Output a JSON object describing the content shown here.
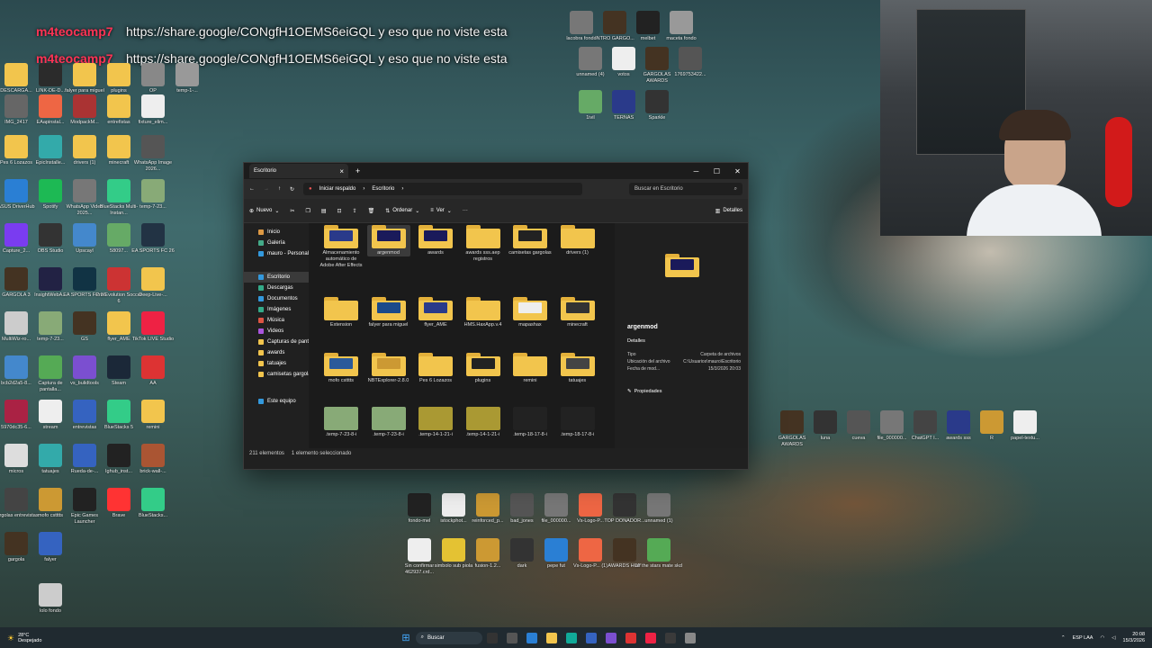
{
  "overlay": {
    "line1_user": "m4teocamp7",
    "line1_text": "https://share.google/CONgfH1OEMS6eiGQL y eso que no viste esta",
    "line2_user": "m4teocamp7",
    "line2_text": "https://share.google/CONgfH1OEMS6eiGQL y eso que no viste esta"
  },
  "desktop_icons": [
    {
      "label": "DESCARGA...",
      "color": "#f2c54d"
    },
    {
      "label": "LINK-DE-D...",
      "color": "#2b2b2b"
    },
    {
      "label": "falyer para miguel",
      "color": "#f2c54d"
    },
    {
      "label": "plugins",
      "color": "#f2c54d"
    },
    {
      "label": "OP",
      "color": "#888"
    },
    {
      "label": "temp-1-...",
      "color": "#999"
    },
    {
      "label": "IMG_2417",
      "color": "#666"
    },
    {
      "label": "EAapinstal...",
      "color": "#e64"
    },
    {
      "label": "ModpackM...",
      "color": "#a33"
    },
    {
      "label": "entrefistas",
      "color": "#f2c54d"
    },
    {
      "label": "fixture_elim...",
      "color": "#eee"
    },
    {
      "label": "Pes 6 Lozazos",
      "color": "#f2c54d"
    },
    {
      "label": "EpicInstalle...",
      "color": "#3aa"
    },
    {
      "label": "drivers (1)",
      "color": "#f2c54d"
    },
    {
      "label": "minecraft",
      "color": "#f2c54d"
    },
    {
      "label": "WhatsApp Image 2026...",
      "color": "#555"
    },
    {
      "label": "ASUS DriverHub",
      "color": "#2a7fd4"
    },
    {
      "label": "Spotify",
      "color": "#1db954"
    },
    {
      "label": "WhatsApp Video 2025...",
      "color": "#777"
    },
    {
      "label": "BlueStacks Multi-Instan...",
      "color": "#3c8"
    },
    {
      "label": "temp-7-23...",
      "color": "#8a7"
    },
    {
      "label": "Capture_2...",
      "color": "#7a3cf0"
    },
    {
      "label": "OBS Studio",
      "color": "#333"
    },
    {
      "label": "Upscayl",
      "color": "#48c"
    },
    {
      "label": "58097...",
      "color": "#6a6"
    },
    {
      "label": "EA SPORTS FC 26",
      "color": "#234"
    },
    {
      "label": "GARGOLA 3",
      "color": "#432"
    },
    {
      "label": "InsightWebA...",
      "color": "#224"
    },
    {
      "label": "EA SPORTS FC 26",
      "color": "#134"
    },
    {
      "label": "Pro Evolution Soccer 6",
      "color": "#c33"
    },
    {
      "label": "Deep-Live-...",
      "color": "#f2c54d"
    },
    {
      "label": "MultiWiz-ro...",
      "color": "#ccc"
    },
    {
      "label": "temp-7-23...",
      "color": "#8a7"
    },
    {
      "label": "GS",
      "color": "#432"
    },
    {
      "label": "flyer_AME",
      "color": "#f2c54d"
    },
    {
      "label": "TikTok LIVE Studio",
      "color": "#e24"
    },
    {
      "label": "bcb2d2a5-8...",
      "color": "#48c"
    },
    {
      "label": "Captura de pantalla...",
      "color": "#5a5"
    },
    {
      "label": "vs_bulidtools",
      "color": "#7b4fd0"
    },
    {
      "label": "Steam",
      "color": "#1b2838"
    },
    {
      "label": "AA",
      "color": "#d33"
    },
    {
      "label": "5970dc35-6...",
      "color": "#a24"
    },
    {
      "label": "stream",
      "color": "#eee"
    },
    {
      "label": "entrevistas",
      "color": "#3563c0"
    },
    {
      "label": "BlueStacks 5",
      "color": "#3c8"
    },
    {
      "label": "remini",
      "color": "#f2c54d"
    },
    {
      "label": "micros",
      "color": "#ddd"
    },
    {
      "label": "tatuajes",
      "color": "#3aa"
    },
    {
      "label": "Rueda-de-...",
      "color": "#3563c0"
    },
    {
      "label": "Ighub_inst...",
      "color": "#222"
    },
    {
      "label": "brick-wall-...",
      "color": "#a53"
    },
    {
      "label": "gargolas entrevistas",
      "color": "#444"
    },
    {
      "label": "mofo cstttts",
      "color": "#c93"
    },
    {
      "label": "Epic Games Launcher",
      "color": "#222"
    },
    {
      "label": "Brave",
      "color": "#f33"
    },
    {
      "label": "BlueStacks...",
      "color": "#3c8"
    },
    {
      "label": "gargola",
      "color": "#432"
    },
    {
      "label": "falyer",
      "color": "#3563c0"
    },
    {
      "label": "lolo fondo",
      "color": "#ccc"
    },
    {
      "label": "lacobra fondo",
      "color": "#777"
    },
    {
      "label": "INTRO GARGO...",
      "color": "#432"
    },
    {
      "label": "melbet",
      "color": "#222"
    },
    {
      "label": "maceta fondo",
      "color": "#999"
    },
    {
      "label": "unnamed (4)",
      "color": "#777"
    },
    {
      "label": "votos",
      "color": "#eee"
    },
    {
      "label": "GARGOLAS AWARDS",
      "color": "#432"
    },
    {
      "label": "1769753422...",
      "color": "#555"
    },
    {
      "label": "1ivil",
      "color": "#6a6"
    },
    {
      "label": "TERNAS",
      "color": "#2a3a8a"
    },
    {
      "label": "Sparkle",
      "color": "#333"
    }
  ],
  "explorer": {
    "tab_title": "Escritorio",
    "tab_close": "×",
    "tab_new": "+",
    "win_minimize": "─",
    "win_maximize": "☐",
    "win_close": "✕",
    "breadcrumb_root": "Iniciar respaldo",
    "breadcrumb_current": "Escritorio",
    "search_placeholder": "Buscar en Escritorio",
    "toolbar": {
      "new": "Nuevo",
      "sort": "Ordenar",
      "view": "Ver",
      "more": "···",
      "details": "Detalles"
    },
    "nav": [
      {
        "label": "Inicio",
        "color": "#d94"
      },
      {
        "label": "Galería",
        "color": "#4a8"
      },
      {
        "label": "mauro - Personal",
        "color": "#39d"
      },
      {
        "label": "Escritorio",
        "color": "#39d",
        "selected": true
      },
      {
        "label": "Descargas",
        "color": "#3a8"
      },
      {
        "label": "Documentos",
        "color": "#39d"
      },
      {
        "label": "Imágenes",
        "color": "#3a8"
      },
      {
        "label": "Música",
        "color": "#d54"
      },
      {
        "label": "Videos",
        "color": "#a5d"
      },
      {
        "label": "Capturas de pantalla",
        "color": "#f2c54d"
      },
      {
        "label": "awards",
        "color": "#f2c54d"
      },
      {
        "label": "tatuajes",
        "color": "#f2c54d"
      },
      {
        "label": "camisetas gargolas",
        "color": "#f2c54d"
      },
      {
        "label": "Este equipo",
        "color": "#39d"
      }
    ],
    "files": [
      {
        "label": "Almacenamiento automático de Adobe After Effects",
        "thumb": "#2a3a8a"
      },
      {
        "label": "argenmod",
        "thumb": "#1a1a5a",
        "selected": true
      },
      {
        "label": "awards",
        "thumb": "#1a1a5a"
      },
      {
        "label": "awards sss.aep registros",
        "thumb": "#f2c54d"
      },
      {
        "label": "camisetas gargolas",
        "thumb": "#222"
      },
      {
        "label": "drivers (1)",
        "thumb": "#f2c54d"
      },
      {
        "label": "Extension",
        "thumb": "#f2c54d"
      },
      {
        "label": "falyer para miguel",
        "thumb": "#1a4a8a"
      },
      {
        "label": "flyer_AME",
        "thumb": "#2a3a8a"
      },
      {
        "label": "HMS.HaxApp.v.4",
        "thumb": "#f2c54d"
      },
      {
        "label": "mapashax",
        "thumb": "#eee"
      },
      {
        "label": "minecraft",
        "thumb": "#333"
      },
      {
        "label": "mofo cstttts",
        "thumb": "#2a5a9a"
      },
      {
        "label": "NBTExplorer-2.8.0",
        "thumb": "#c93"
      },
      {
        "label": "Pes 6 Lozazos",
        "thumb": "#f2c54d"
      },
      {
        "label": "plugins",
        "thumb": "#222"
      },
      {
        "label": "remini",
        "thumb": "#f2c54d"
      },
      {
        "label": "tatuajes",
        "thumb": "#444"
      },
      {
        "label": ".temp-7-23-8-i",
        "thumb": "#8a7"
      },
      {
        "label": ".temp-7-23-8-i",
        "thumb": "#8a7"
      },
      {
        "label": ".temp-14-1-21-i",
        "thumb": "#a93"
      },
      {
        "label": ".temp-14-1-21-i",
        "thumb": "#a93"
      },
      {
        "label": ".temp-18-17-8-i",
        "thumb": "#222"
      },
      {
        "label": ".temp-18-17-8-i",
        "thumb": "#222"
      }
    ],
    "details_pane": {
      "name": "argenmod",
      "section": "Detalles",
      "rows": [
        {
          "k": "Tipo",
          "v": "Carpeta de archivos"
        },
        {
          "k": "Ubicación del archivo",
          "v": "C:\\Usuarios\\mauro\\Escritorio"
        },
        {
          "k": "Fecha de mod...",
          "v": "15/3/2026 20:03"
        }
      ],
      "properties": "Propiedades"
    },
    "status": {
      "count": "211 elementos",
      "selected": "1 elemento seleccionado"
    }
  },
  "bottom_icons": [
    {
      "label": "fondo-mel",
      "color": "#222"
    },
    {
      "label": "istockphot...",
      "color": "#eee"
    },
    {
      "label": "reinforced_p...",
      "color": "#c93"
    },
    {
      "label": "bad_jones",
      "color": "#555"
    },
    {
      "label": "file_000000...",
      "color": "#777"
    },
    {
      "label": "Vs-Logo-P...",
      "color": "#e64"
    },
    {
      "label": "TOP DONADOR...",
      "color": "#333"
    },
    {
      "label": "unnamed (1)",
      "color": "#777"
    },
    {
      "label": "Sin confirmar 462937.crd...",
      "color": "#eee"
    },
    {
      "label": "simbolo sub piola",
      "color": "#e4c233"
    },
    {
      "label": "fusion-1.2...",
      "color": "#c93"
    },
    {
      "label": "dark",
      "color": "#333"
    },
    {
      "label": "pepe fut",
      "color": "#2a7fd4"
    },
    {
      "label": "Vs-Logo-P... (1)",
      "color": "#e64"
    },
    {
      "label": "AWARDS HOY",
      "color": "#432"
    },
    {
      "label": "all the stars mate skd",
      "color": "#5a5"
    }
  ],
  "right_icons": [
    {
      "label": "GARGOLAS AWARDS",
      "color": "#432"
    },
    {
      "label": "luna",
      "color": "#333"
    },
    {
      "label": "cueva",
      "color": "#555"
    },
    {
      "label": "file_000000...",
      "color": "#777"
    },
    {
      "label": "ChatGPT I...",
      "color": "#444"
    },
    {
      "label": "awards sss",
      "color": "#2a3a8a"
    },
    {
      "label": "R",
      "color": "#c93"
    },
    {
      "label": "papel-textu...",
      "color": "#eee"
    }
  ],
  "taskbar": {
    "weather_temp": "28°C",
    "weather_desc": "Despejado",
    "search": "Buscar",
    "lang": "ESP LAA",
    "time": "20:08",
    "date": "15/3/2026",
    "icons": [
      "#333",
      "#555",
      "#2a7fd4",
      "#f2c54d",
      "#1a9",
      "#3563c0",
      "#7b4fd0",
      "#d33",
      "#e24",
      "#3a3a3a",
      "#888"
    ]
  }
}
